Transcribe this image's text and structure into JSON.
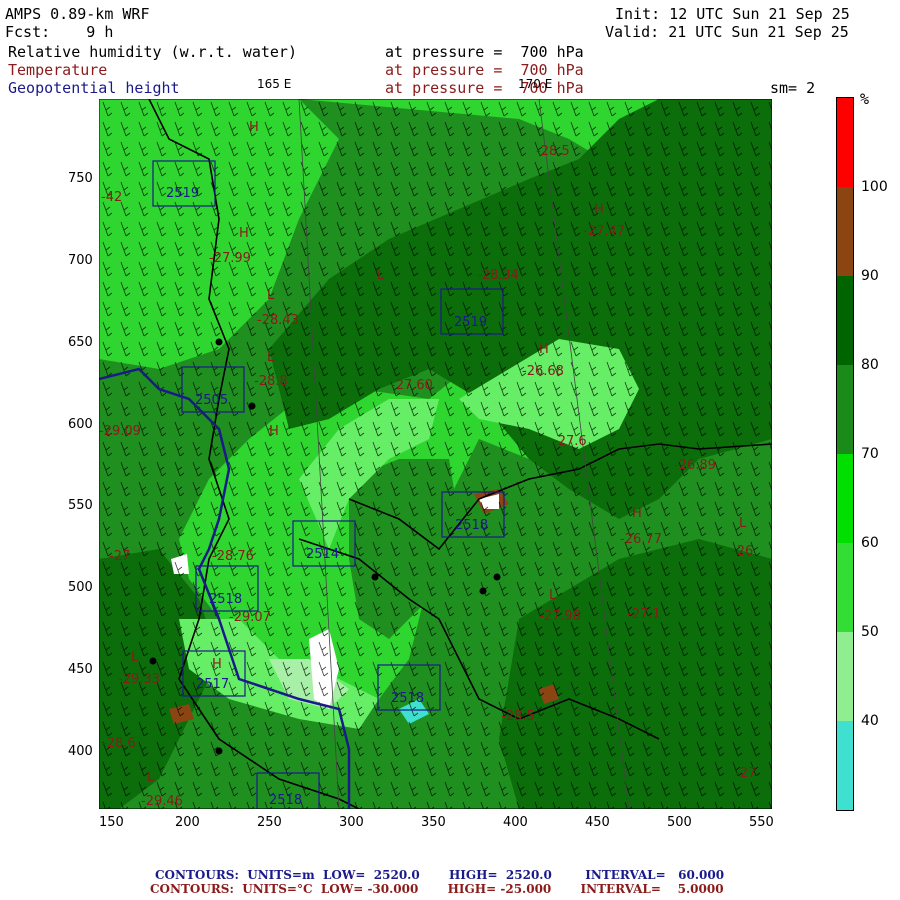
{
  "header": {
    "model": "AMPS 0.89-km WRF",
    "init": "Init: 12 UTC Sun 21 Sep 25",
    "fcst": "Fcst:    9 h",
    "valid": "Valid: 21 UTC Sun 21 Sep 25",
    "field1": "Relative humidity (w.r.t. water)",
    "field1_level": "at pressure =  700 hPa",
    "field2": "Temperature",
    "field2_level": "at pressure =  700 hPa",
    "field3": "Geopotential height",
    "field3_level": "at pressure =  700 hPa",
    "lon_label_left": "165 E",
    "lon_label_right": "170 E",
    "smoothing": "sm= 2"
  },
  "colors": {
    "rh_30_40": "#40e0d0",
    "rh_40_50": "#90ee90",
    "rh_50_60": "#33dd33",
    "rh_60_70": "#00e000",
    "rh_70_80": "#1a8a1a",
    "rh_80_90": "#006400",
    "rh_90_100": "#8b4513",
    "rh_100": "#ff0000",
    "temp_contour": "#8b1a1a",
    "height_contour": "#1a1a8b"
  },
  "colorbar": {
    "unit": "%",
    "labels": [
      "100",
      "90",
      "80",
      "70",
      "60",
      "50",
      "40"
    ]
  },
  "axes": {
    "x_ticks": [
      "150",
      "200",
      "250",
      "300",
      "350",
      "400",
      "450",
      "500",
      "550"
    ],
    "y_ticks": [
      "750",
      "700",
      "650",
      "600",
      "550",
      "500",
      "450",
      "400"
    ]
  },
  "map_labels": {
    "temps": [
      "-28.5",
      "-27.47",
      "-28.34",
      "-27.99",
      "-28.43",
      "-28.8",
      "-27.60",
      "-26.68",
      "-27.6",
      "-26.89",
      "-26.77",
      "-26",
      "-27.98",
      "-27.1",
      "-29.09",
      "-28.76",
      "-29.07",
      "-29.33",
      "-29.46",
      "-27",
      "-27",
      "-42",
      "-28.5",
      "-28.6"
    ],
    "heights": [
      "2519",
      "2505",
      "2519",
      "2514",
      "2518",
      "2518",
      "2517",
      "2518",
      "2518"
    ],
    "highs": [
      "H",
      "H",
      "H",
      "H",
      "H",
      "H",
      "H"
    ],
    "lows": [
      "L",
      "L",
      "L",
      "L",
      "L",
      "L",
      "L"
    ]
  },
  "footer": {
    "height_line": "CONTOURS:  UNITS=m  LOW=  2520.0       HIGH=  2520.0        INTERVAL=   60.000",
    "temp_line": "CONTOURS:  UNITS=°C  LOW= -30.000       HIGH= -25.000       INTERVAL=    5.0000"
  }
}
